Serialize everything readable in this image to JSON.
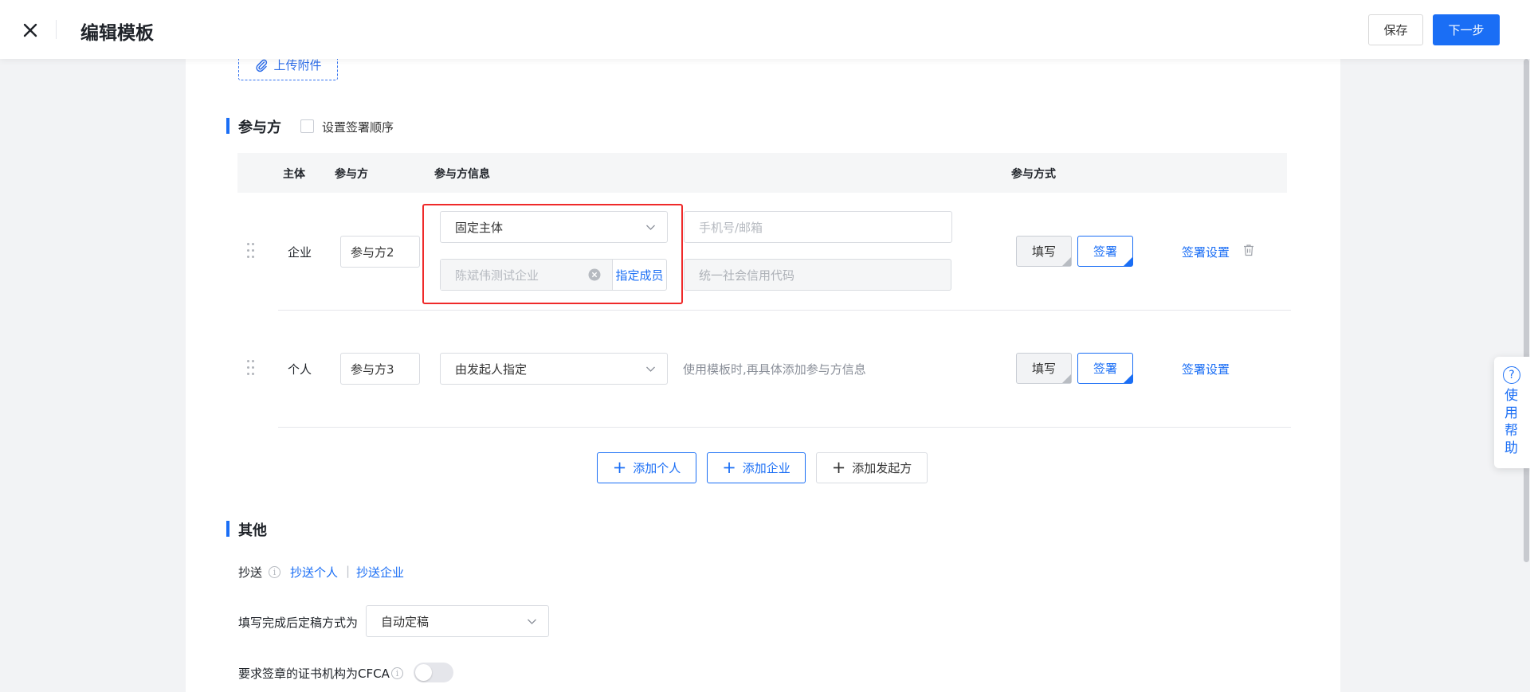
{
  "header": {
    "title": "编辑模板",
    "save_label": "保存",
    "next_label": "下一步"
  },
  "attachment": {
    "upload_label": "上传附件"
  },
  "participants": {
    "title": "参与方",
    "order_checkbox_label": "设置签署顺序",
    "columns": {
      "subject": "主体",
      "party": "参与方",
      "info": "参与方信息",
      "method": "参与方式"
    },
    "rows": [
      {
        "subject": "企业",
        "party_name": "参与方2",
        "subject_type": "固定主体",
        "company_placeholder": "陈斌伟测试企业",
        "assign_member": "指定成员",
        "contact_placeholder": "手机号/邮箱",
        "credit_code_placeholder": "统一社会信用代码",
        "method_fill": "填写",
        "method_sign": "签署",
        "settings": "签署设置"
      },
      {
        "subject": "个人",
        "party_name": "参与方3",
        "subject_type": "由发起人指定",
        "hint": "使用模板时,再具体添加参与方信息",
        "method_fill": "填写",
        "method_sign": "签署",
        "settings": "签署设置"
      }
    ],
    "add_person": "添加个人",
    "add_company": "添加企业",
    "add_initiator": "添加发起方"
  },
  "other": {
    "title": "其他",
    "cc_label": "抄送",
    "cc_person": "抄送个人",
    "cc_separator": "|",
    "cc_company": "抄送企业",
    "finalize_label": "填写完成后定稿方式为",
    "finalize_value": "自动定稿",
    "cfca_label": "要求签章的证书机构为CFCA",
    "cfca_enabled": false
  },
  "help_widget": {
    "label": "使用帮助",
    "icon": "?"
  },
  "colors": {
    "primary": "#1a6ef5",
    "highlight": "#ef2a2a"
  }
}
